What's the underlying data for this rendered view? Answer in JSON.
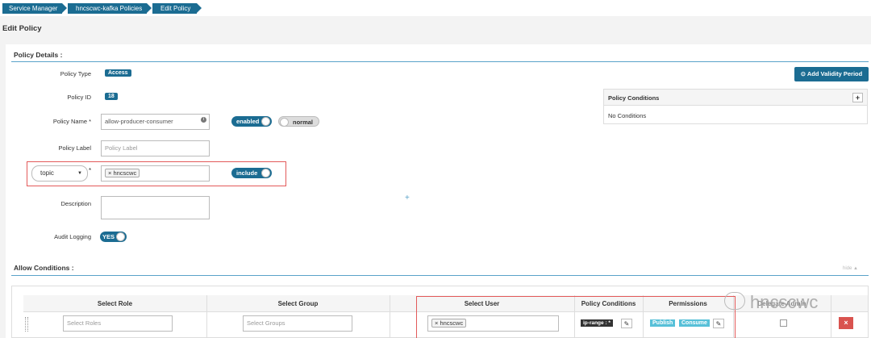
{
  "breadcrumb": {
    "items": [
      "Service Manager",
      "hncscwc-kafka Policies",
      "Edit Policy"
    ]
  },
  "page": {
    "title": "Edit Policy"
  },
  "details": {
    "section_title": "Policy Details :",
    "policy_type_label": "Policy Type",
    "policy_type_value": "Access",
    "policy_id_label": "Policy ID",
    "policy_id_value": "18",
    "policy_name_label": "Policy Name *",
    "policy_name_value": "allow-producer-consumer",
    "enabled_label": "enabled",
    "normal_label": "normal",
    "policy_label_label": "Policy Label",
    "policy_label_placeholder": "Policy Label",
    "resource_type": "topic",
    "resource_required": "*",
    "resource_tag": "hncscwc",
    "include_label": "include",
    "description_label": "Description",
    "audit_logging_label": "Audit Logging",
    "audit_logging_value": "YES",
    "add_validity_label": "Add Validity Period",
    "policy_conditions_title": "Policy Conditions",
    "policy_conditions_add": "+",
    "policy_conditions_empty": "No Conditions"
  },
  "allow": {
    "section_title": "Allow Conditions :",
    "hide_label": "hide ▲",
    "columns": [
      "Select Role",
      "Select Group",
      "Select User",
      "Policy Conditions",
      "Permissions",
      "Delegate Admin"
    ],
    "row": {
      "roles_placeholder": "Select Roles",
      "groups_placeholder": "Select Groups",
      "user_tag": "hncscwc",
      "condition_tag": "ip-range : *",
      "permissions": [
        "Publish",
        "Consume"
      ]
    }
  },
  "watermark": {
    "text": "hncscwc"
  }
}
